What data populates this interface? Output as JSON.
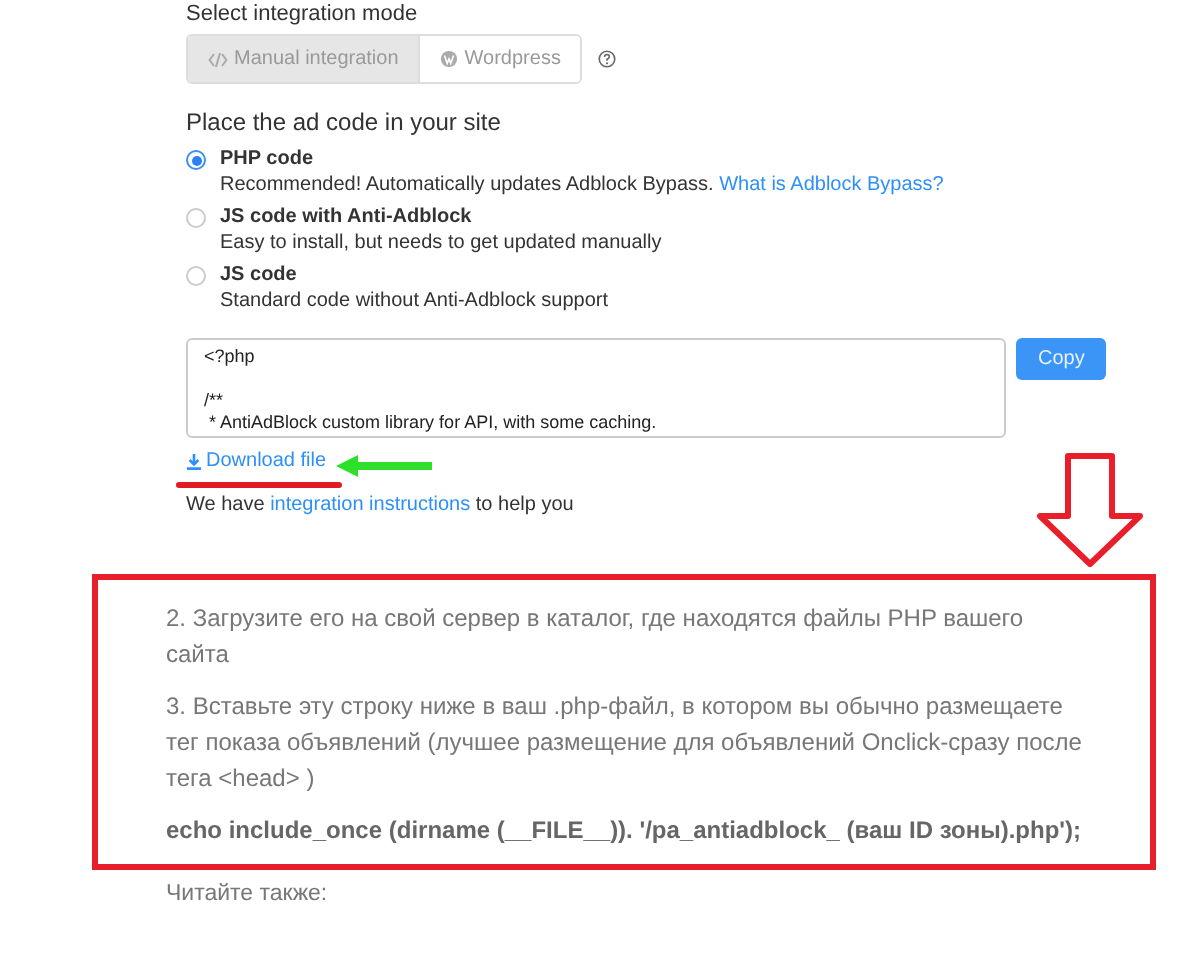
{
  "integration": {
    "title": "Select integration mode",
    "modes": [
      {
        "kind": "code",
        "label": "Manual integration",
        "selected": true
      },
      {
        "kind": "wordpress",
        "label": "Wordpress",
        "selected": false
      }
    ]
  },
  "placement": {
    "title": "Place the ad code in your site",
    "options": [
      {
        "label": "PHP code",
        "description": "Recommended! Automatically updates Adblock Bypass.",
        "link": "What is Adblock Bypass?",
        "selected": true
      },
      {
        "label": "JS code with Anti-Adblock",
        "description": "Easy to install, but needs to get updated manually",
        "selected": false
      },
      {
        "label": "JS code",
        "description": "Standard code without Anti-Adblock support",
        "selected": false
      }
    ]
  },
  "code": {
    "value": "<?php\n\n/**\n * AntiAdBlock custom library for API, with some caching.",
    "copy_button": "Copy"
  },
  "download": {
    "label": "Download file"
  },
  "help": {
    "prefix": "We have ",
    "link": "integration instructions",
    "suffix": " to help you"
  },
  "article": {
    "paragraphs": [
      {
        "kind": "text",
        "text": "2. Загрузите его на свой сервер в каталог, где находятся файлы PHP вашего сайта"
      },
      {
        "kind": "text",
        "text": "3. Вставьте эту строку ниже в ваш .php-файл, в котором вы обычно размещаете тег показа объявлений (лучшее размещение для объявлений Onclick-сразу после тега <head> )"
      },
      {
        "kind": "code",
        "text": "echo include_once (dirname (__FILE__)). '/pa_antiadblock_ (ваш ID зоны).php');"
      }
    ],
    "read_also": "Читайте также:"
  }
}
